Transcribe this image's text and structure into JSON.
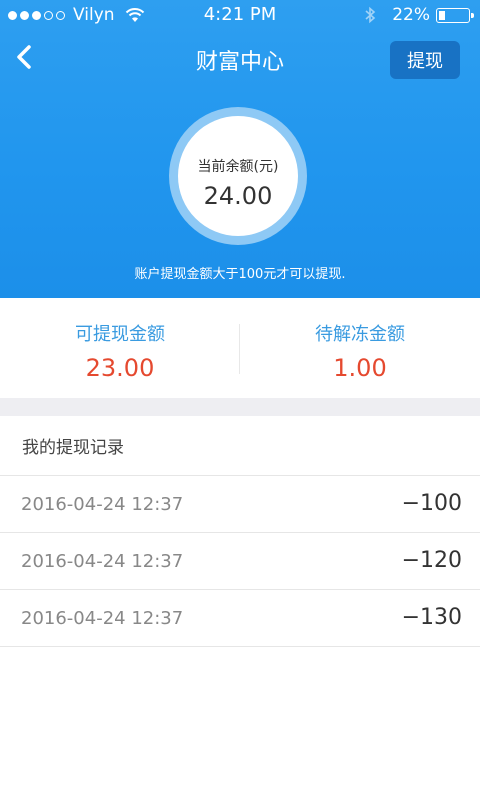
{
  "status_bar": {
    "carrier": "Vilyn",
    "time": "4:21 PM",
    "battery_text": "22%",
    "battery_level": 0.22
  },
  "nav": {
    "title": "财富中心",
    "withdraw_label": "提现"
  },
  "balance": {
    "label": "当前余额(元)",
    "value": "24.00"
  },
  "hint": "账户提现金额大于100元才可以提现.",
  "stats": {
    "withdrawable_label": "可提现金额",
    "withdrawable_value": "23.00",
    "frozen_label": "待解冻金额",
    "frozen_value": "1.00"
  },
  "records": {
    "title": "我的提现记录",
    "items": [
      {
        "date": "2016-04-24 12:37",
        "amount": "−100"
      },
      {
        "date": "2016-04-24 12:37",
        "amount": "−120"
      },
      {
        "date": "2016-04-24 12:37",
        "amount": "−130"
      }
    ]
  },
  "colors": {
    "header_blue": "#2196ee",
    "button_blue": "#1872c4",
    "stat_label_blue": "#3a9be0",
    "stat_value_red": "#e5492f"
  }
}
